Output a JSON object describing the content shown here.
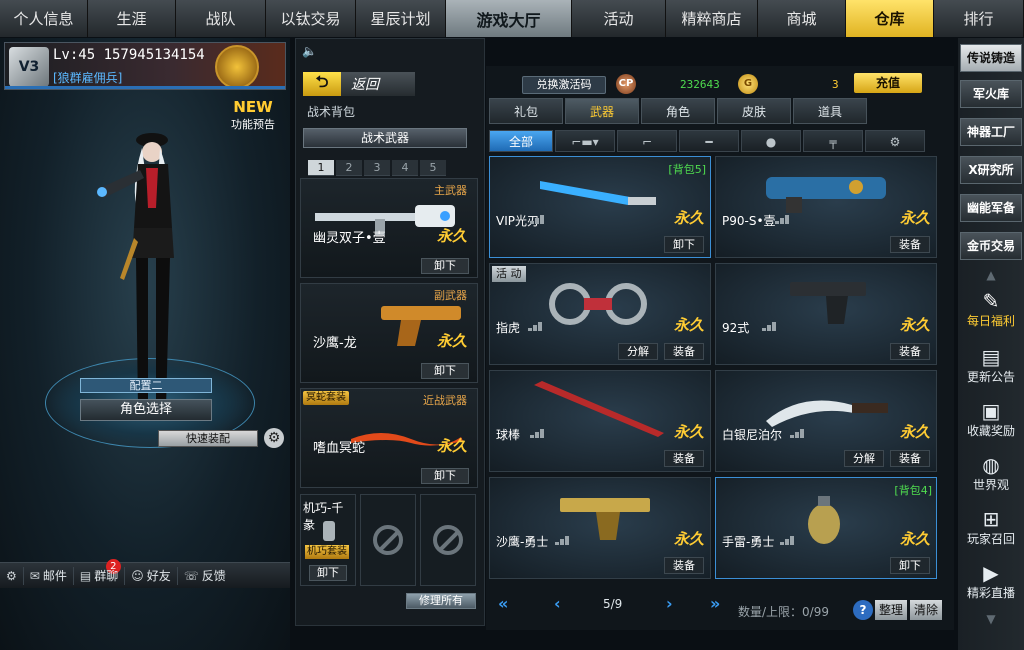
{
  "nav": {
    "tabs": [
      "个人信息",
      "生涯",
      "战队",
      "以钛交易",
      "星辰计划",
      "游戏大厅",
      "活动",
      "精粹商店",
      "商城",
      "仓库",
      "排行"
    ]
  },
  "profile": {
    "vip": "V3",
    "level_id": "Lv:45 157945134154",
    "clan": "[狼群雇佣兵]"
  },
  "new_feature": {
    "new": "NEW",
    "label": "功能预告"
  },
  "character": {
    "preset": "配置二",
    "role_select": "角色选择",
    "quick_equip": "快速装配"
  },
  "bottom_bar": {
    "mail": "邮件",
    "mail_count": "2",
    "group_chat": "群聊",
    "friends": "好友",
    "feedback": "反馈"
  },
  "loadout": {
    "back": "返回",
    "bag_title": "战术背包",
    "tactical_weapon": "战术武器",
    "pages": [
      "1",
      "2",
      "3",
      "4",
      "5"
    ],
    "slots": [
      {
        "category": "主武器",
        "name": "幽灵双子•壹",
        "duration": "永久",
        "action": "卸下",
        "tag": ""
      },
      {
        "category": "副武器",
        "name": "沙鹰-龙",
        "duration": "永久",
        "action": "卸下",
        "tag": ""
      },
      {
        "category": "近战武器",
        "name": "嗜血冥蛇",
        "duration": "永久",
        "action": "卸下",
        "tag": "冥蛇套装"
      }
    ],
    "gadget": {
      "name": "机巧-千彖",
      "tag": "机巧套装",
      "action": "卸下"
    },
    "repair_all": "修理所有"
  },
  "currency": {
    "redeem": "兑换激活码",
    "cp_icon": "CP",
    "cp_value": "232643",
    "gold_icon": "G",
    "gold_value": "3",
    "recharge": "充值"
  },
  "category_tabs": [
    "礼包",
    "武器",
    "角色",
    "皮肤",
    "道具"
  ],
  "sub_tabs": {
    "all": "全部"
  },
  "items": [
    {
      "name": "VIP光刃",
      "duration": "永久",
      "bag": "[背包5]",
      "actions": [
        "卸下"
      ],
      "event": ""
    },
    {
      "name": "P90-S•壹",
      "duration": "永久",
      "bag": "",
      "actions": [
        "装备"
      ],
      "event": ""
    },
    {
      "name": "指虎",
      "duration": "永久",
      "bag": "",
      "actions": [
        "分解",
        "装备"
      ],
      "event": "活 动"
    },
    {
      "name": "92式",
      "duration": "永久",
      "bag": "",
      "actions": [
        "装备"
      ],
      "event": ""
    },
    {
      "name": "球棒",
      "duration": "永久",
      "bag": "",
      "actions": [
        "装备"
      ],
      "event": ""
    },
    {
      "name": "白银尼泊尔",
      "duration": "永久",
      "bag": "",
      "actions": [
        "分解",
        "装备"
      ],
      "event": ""
    },
    {
      "name": "沙鹰-勇士",
      "duration": "永久",
      "bag": "",
      "actions": [
        "装备"
      ],
      "event": ""
    },
    {
      "name": "手雷-勇士",
      "duration": "永久",
      "bag": "[背包4]",
      "actions": [
        "卸下"
      ],
      "event": ""
    }
  ],
  "pager": {
    "page": "5/9",
    "quota": "数量/上限：0/99",
    "sort": "整理",
    "clear": "清除",
    "help": "?"
  },
  "sidebar": {
    "buttons": [
      "传说铸造",
      "军火库",
      "神器工厂",
      "X研究所",
      "幽能军备",
      "金币交易"
    ],
    "icons": [
      {
        "label": "每日福利",
        "icon": "daily-welfare-icon"
      },
      {
        "label": "更新公告",
        "icon": "announcement-icon"
      },
      {
        "label": "收藏奖励",
        "icon": "collection-icon"
      },
      {
        "label": "世界观",
        "icon": "globe-icon"
      },
      {
        "label": "玩家召回",
        "icon": "gift-icon"
      },
      {
        "label": "精彩直播",
        "icon": "live-icon"
      }
    ]
  }
}
